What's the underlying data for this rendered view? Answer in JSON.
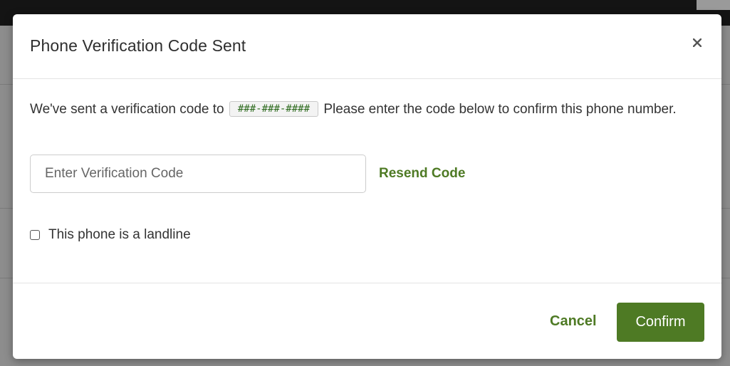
{
  "modal": {
    "title": "Phone Verification Code Sent",
    "close_icon": "close-icon",
    "message_before": "We've sent a verification code to",
    "masked_phone": "###-###-####",
    "message_after": "Please enter the code below to confirm this phone number.",
    "code_input": {
      "placeholder": "Enter Verification Code",
      "value": ""
    },
    "resend_label": "Resend Code",
    "landline_label": "This phone is a landline",
    "landline_checked": false,
    "cancel_label": "Cancel",
    "confirm_label": "Confirm"
  },
  "colors": {
    "accent": "#4e7a24",
    "overlay": "#8d8d8d",
    "code_text": "#2e6b1f"
  }
}
